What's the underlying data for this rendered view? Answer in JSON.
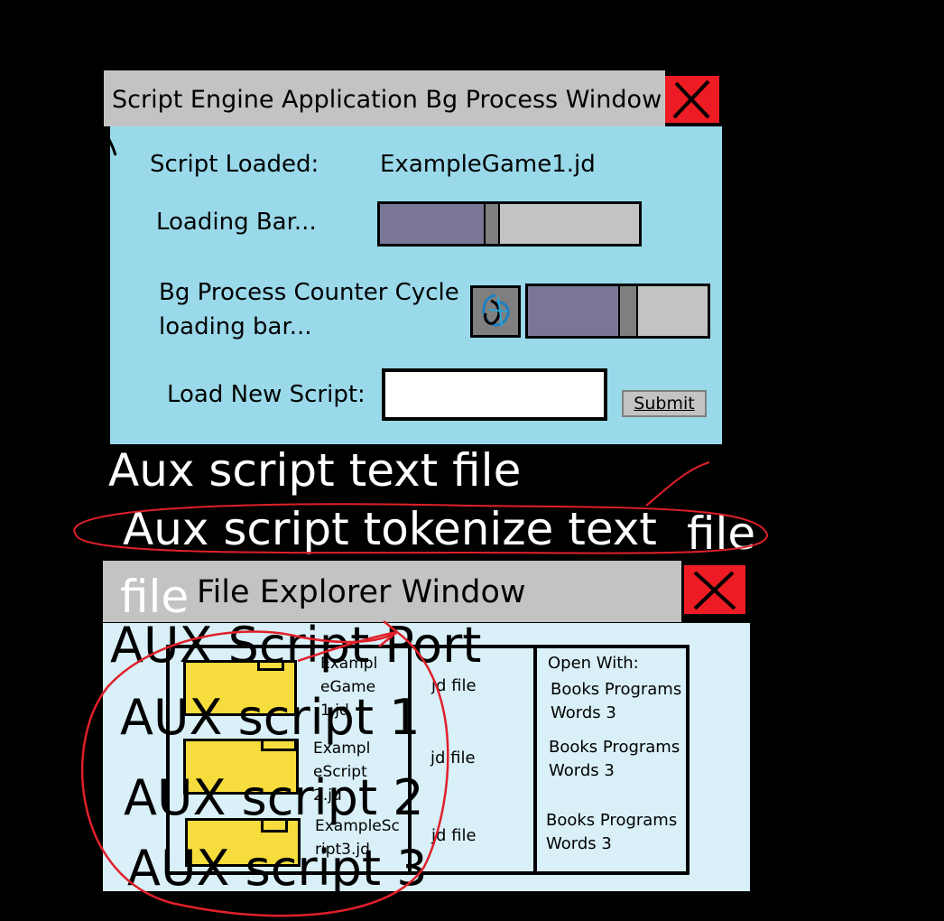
{
  "window1": {
    "title": "Script Engine Application Bg Process Window",
    "script_loaded_label": "Script Loaded:",
    "script_loaded_value": "ExampleGame1.jd",
    "loading_bar_label": "Loading Bar...",
    "loading_bar_progress": 0.4,
    "bg_process_label_line1": "Bg Process Counter Cycle",
    "bg_process_label_line2": "loading bar...",
    "bg_process_progress": 0.5,
    "load_new_script_label": "Load New Script:",
    "load_new_script_value": "",
    "submit_label": "Submit"
  },
  "annotations": {
    "aux_script_text_file": "Aux script text file",
    "aux_script_tokenize": "Aux script tokenize text",
    "aux_file_suffix": "file",
    "file_word": "file",
    "aux_script_port": "AUX Script Port",
    "aux_script_1": "AUX script 1",
    "aux_script_2": "AUX script 2",
    "aux_script_3": "AUX script 3"
  },
  "window2": {
    "title": "File Explorer Window",
    "open_with_label": "Open With:",
    "files": [
      {
        "name": "ExampleGame1.jd",
        "type": "jd file",
        "open_with_line1": "Books Programs",
        "open_with_line2": "Words 3"
      },
      {
        "name": "ExampleScript2.jd",
        "type": "jd file",
        "open_with_line1": "Books Programs",
        "open_with_line2": "Words 3"
      },
      {
        "name": "ExampleScript3.jd",
        "type": "jd file",
        "open_with_line1": "Books Programs",
        "open_with_line2": "Words 3"
      }
    ]
  },
  "colors": {
    "background": "#000000",
    "titlebar": "#c3c3c3",
    "window1_body": "#99d9ea",
    "window2_body": "#d9f0f8",
    "close_red": "#ed1c24",
    "bar_fill": "#7a7796",
    "folder_yellow": "#f6dc3c",
    "annotation_circle": "#e0202a"
  },
  "icons": [
    "close-x-icon",
    "spinner-icon",
    "folder-icon"
  ]
}
